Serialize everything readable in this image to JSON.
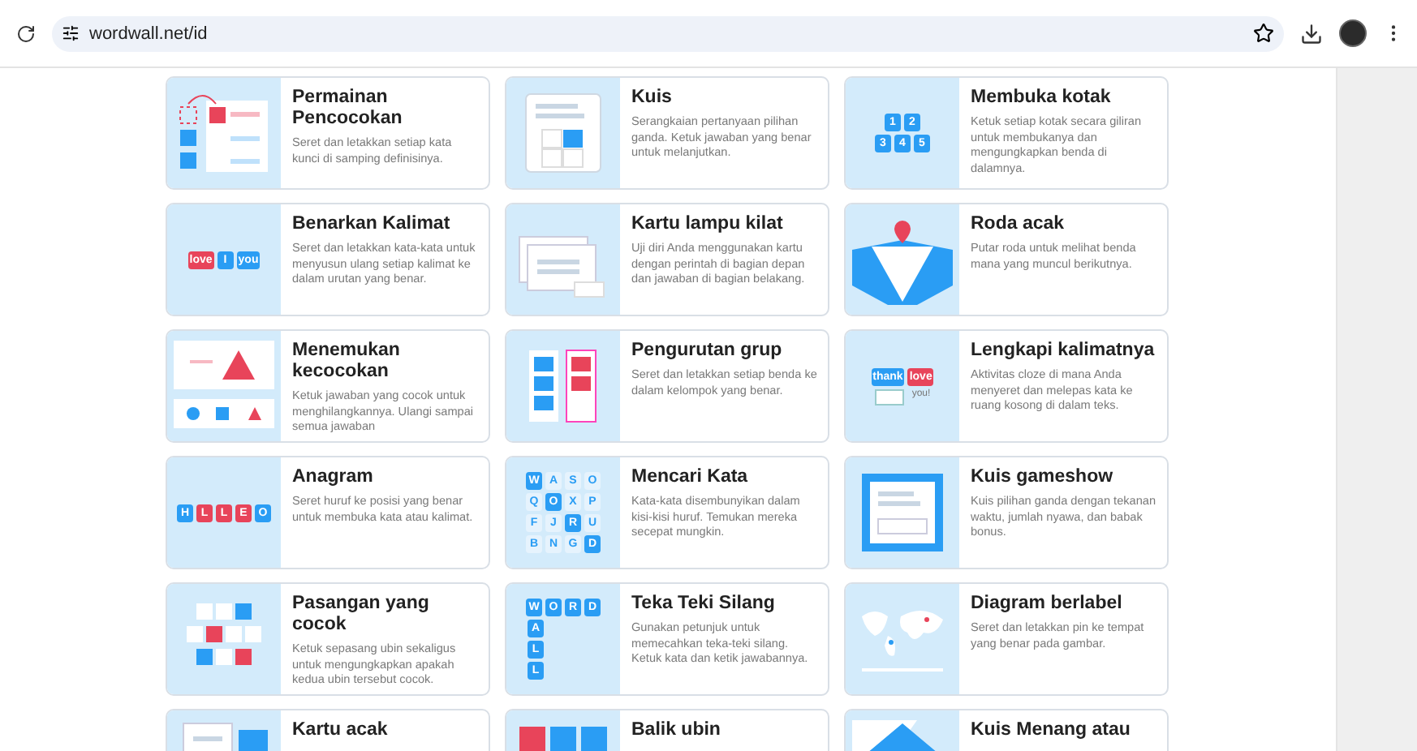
{
  "browser": {
    "url": "wordwall.net/id"
  },
  "cards": [
    {
      "title": "Permainan Pencocokan",
      "description": "Seret dan letakkan setiap kata kunci di samping definisinya.",
      "thumb": {
        "kind": "match"
      }
    },
    {
      "title": "Kuis",
      "description": "Serangkaian pertanyaan pilihan ganda. Ketuk jawaban yang benar untuk melanjutkan.",
      "thumb": {
        "kind": "quiz"
      }
    },
    {
      "title": "Membuka kotak",
      "description": "Ketuk setiap kotak secara giliran untuk membukanya dan mengungkapkan benda di dalamnya.",
      "thumb": {
        "kind": "tiles",
        "rows": [
          [
            {
              "text": "1",
              "color": "#2a9df4"
            },
            {
              "text": "2",
              "color": "#2a9df4"
            }
          ],
          [
            {
              "text": "3",
              "color": "#2a9df4"
            },
            {
              "text": "4",
              "color": "#2a9df4"
            },
            {
              "text": "5",
              "color": "#2a9df4"
            }
          ]
        ]
      }
    },
    {
      "title": "Benarkan Kalimat",
      "description": "Seret dan letakkan kata-kata untuk menyusun ulang setiap kalimat ke dalam urutan yang benar.",
      "thumb": {
        "kind": "tiles",
        "rows": [
          [
            {
              "text": "love",
              "color": "#e8445a"
            },
            {
              "text": "I",
              "color": "#2a9df4"
            },
            {
              "text": "you",
              "color": "#2a9df4"
            }
          ]
        ]
      }
    },
    {
      "title": "Kartu lampu kilat",
      "description": "Uji diri Anda menggunakan kartu dengan perintah di bagian depan dan jawaban di bagian belakang.",
      "thumb": {
        "kind": "flash"
      }
    },
    {
      "title": "Roda acak",
      "description": "Putar roda untuk melihat benda mana yang muncul berikutnya.",
      "thumb": {
        "kind": "wheel"
      }
    },
    {
      "title": "Menemukan kecocokan",
      "description": "Ketuk jawaban yang cocok untuk menghilangkannya. Ulangi sampai semua jawaban",
      "thumb": {
        "kind": "find"
      }
    },
    {
      "title": "Pengurutan grup",
      "description": "Seret dan letakkan setiap benda ke dalam kelompok yang benar.",
      "thumb": {
        "kind": "group"
      }
    },
    {
      "title": "Lengkapi kalimatnya",
      "description": "Aktivitas cloze di mana Anda menyeret dan melepas kata ke ruang kosong di dalam teks.",
      "thumb": {
        "kind": "cloze",
        "chips": [
          {
            "text": "thank",
            "color": "#2a9df4"
          },
          {
            "text": "love",
            "color": "#e8445a"
          }
        ],
        "answer": "you!"
      }
    },
    {
      "title": "Anagram",
      "description": "Seret huruf ke posisi yang benar untuk membuka kata atau kalimat.",
      "thumb": {
        "kind": "tiles",
        "rows": [
          [
            {
              "text": "H",
              "color": "#2a9df4"
            },
            {
              "text": "L",
              "color": "#e8445a"
            },
            {
              "text": "L",
              "color": "#e8445a"
            },
            {
              "text": "E",
              "color": "#e8445a"
            },
            {
              "text": "O",
              "color": "#2a9df4"
            }
          ]
        ]
      }
    },
    {
      "title": "Mencari Kata",
      "description": "Kata-kata disembunyikan dalam kisi-kisi huruf. Temukan mereka secepat mungkin.",
      "thumb": {
        "kind": "tiles",
        "rows": [
          [
            {
              "text": "W",
              "color": "#2a9df4"
            },
            {
              "text": "A",
              "color": "#e6f3fd"
            },
            {
              "text": "S",
              "color": "#e6f3fd"
            },
            {
              "text": "O",
              "color": "#e6f3fd"
            }
          ],
          [
            {
              "text": "Q",
              "color": "#e6f3fd"
            },
            {
              "text": "O",
              "color": "#2a9df4"
            },
            {
              "text": "X",
              "color": "#e6f3fd"
            },
            {
              "text": "P",
              "color": "#e6f3fd"
            }
          ],
          [
            {
              "text": "F",
              "color": "#e6f3fd"
            },
            {
              "text": "J",
              "color": "#e6f3fd"
            },
            {
              "text": "R",
              "color": "#2a9df4"
            },
            {
              "text": "U",
              "color": "#e6f3fd"
            }
          ],
          [
            {
              "text": "B",
              "color": "#e6f3fd"
            },
            {
              "text": "N",
              "color": "#e6f3fd"
            },
            {
              "text": "G",
              "color": "#e6f3fd"
            },
            {
              "text": "D",
              "color": "#2a9df4"
            }
          ]
        ]
      }
    },
    {
      "title": "Kuis gameshow",
      "description": "Kuis pilihan ganda dengan tekanan waktu, jumlah nyawa, dan babak bonus.",
      "thumb": {
        "kind": "gameshow"
      }
    },
    {
      "title": "Pasangan yang cocok",
      "description": "Ketuk sepasang ubin sekaligus untuk mengungkapkan apakah kedua ubin tersebut cocok.",
      "thumb": {
        "kind": "pairs"
      }
    },
    {
      "title": "Teka Teki Silang",
      "description": "Gunakan petunjuk untuk memecahkan teka-teki silang. Ketuk kata dan ketik jawabannya.",
      "thumb": {
        "kind": "crossword",
        "across": [
          "W",
          "O",
          "R",
          "D"
        ],
        "down": [
          "A",
          "L",
          "L"
        ]
      }
    },
    {
      "title": "Diagram berlabel",
      "description": "Seret dan letakkan pin ke tempat yang benar pada gambar.",
      "thumb": {
        "kind": "map"
      }
    },
    {
      "title": "Kartu acak",
      "thumb": {
        "kind": "deck"
      }
    },
    {
      "title": "Balik ubin",
      "thumb": {
        "kind": "flip"
      }
    },
    {
      "title": "Kuis Menang atau",
      "thumb": {
        "kind": "winlose"
      }
    }
  ]
}
